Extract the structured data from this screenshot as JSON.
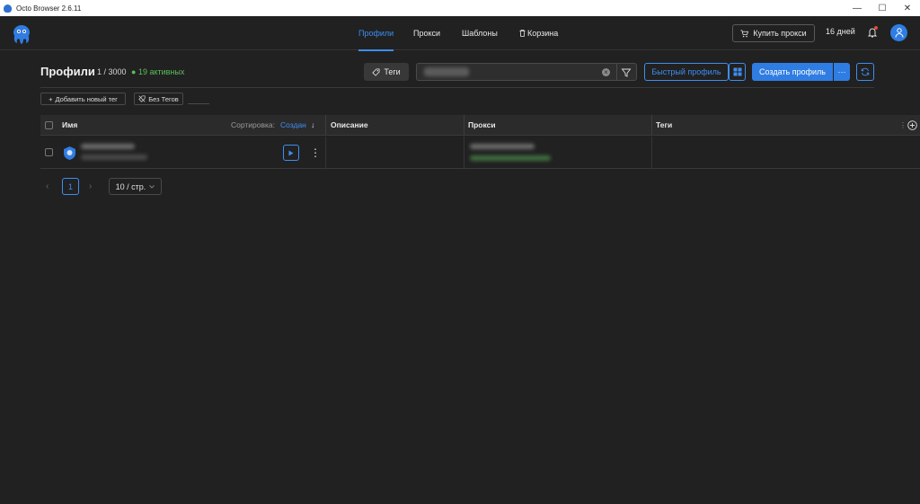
{
  "window": {
    "title": "Octo Browser 2.6.11",
    "controls": {
      "minimize": "—",
      "maximize": "☐",
      "close": "✕"
    }
  },
  "header": {
    "logo_icon": "octopus-logo-icon",
    "nav": [
      {
        "label": "Профили",
        "active": true
      },
      {
        "label": "Прокси",
        "active": false
      },
      {
        "label": "Шаблоны",
        "active": false
      },
      {
        "label": "Корзина",
        "active": false
      }
    ],
    "buy_proxy_label": "Купить прокси",
    "days_left": "16 дней",
    "accent_color": "#2f7de3"
  },
  "toolbar": {
    "title": "Профили",
    "count": "1 / 3000",
    "active_count": "19 активных",
    "tags_button": "Теги",
    "quick_profile_button": "Быстрый профиль",
    "create_profile_button": "Создать профиль",
    "more_button": "···"
  },
  "tag_filters": {
    "add_tag_label": "Добавить новый тег",
    "no_tags_label": "Без Тегов"
  },
  "table": {
    "columns": {
      "name": "Имя",
      "sort_label": "Сортировка:",
      "sort_value": "Создан",
      "sort_arrow": "↓",
      "description": "Описание",
      "proxy": "Прокси",
      "tags": "Теги"
    },
    "rows_count_visible": 1
  },
  "pagination": {
    "prev": "‹",
    "current_page": "1",
    "next": "›",
    "page_size": "10 / стр."
  }
}
